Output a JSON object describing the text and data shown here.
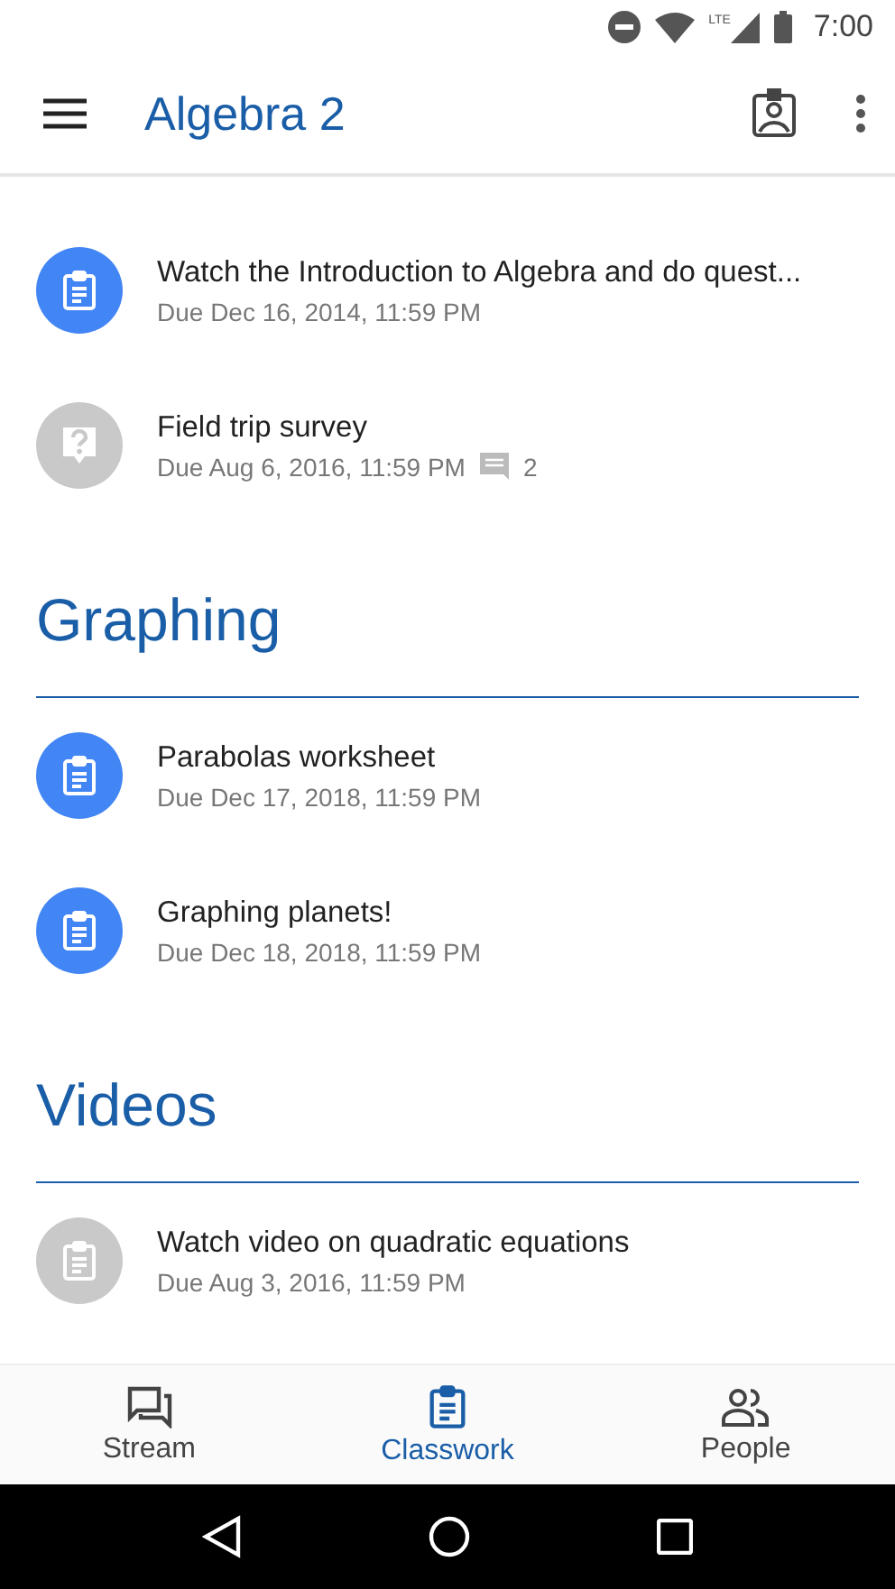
{
  "status_bar": {
    "time": "7:00",
    "network": "LTE"
  },
  "app_bar": {
    "title": "Algebra 2"
  },
  "sections": [
    {
      "items": [
        {
          "kind": "assignment",
          "active": true,
          "title": "Watch the Introduction to Algebra and do quest...",
          "due": "Due Dec 16, 2014, 11:59 PM"
        },
        {
          "kind": "question",
          "active": false,
          "title": "Field trip survey",
          "due": "Due Aug 6, 2016, 11:59 PM",
          "comments": "2"
        }
      ]
    },
    {
      "title": "Graphing",
      "items": [
        {
          "kind": "assignment",
          "active": true,
          "title": "Parabolas worksheet",
          "due": "Due Dec 17, 2018, 11:59 PM"
        },
        {
          "kind": "assignment",
          "active": true,
          "title": "Graphing planets!",
          "due": "Due Dec 18, 2018, 11:59 PM"
        }
      ]
    },
    {
      "title": "Videos",
      "items": [
        {
          "kind": "assignment",
          "active": false,
          "title": "Watch video on quadratic equations",
          "due": "Due Aug 3, 2016, 11:59 PM"
        }
      ]
    }
  ],
  "bottom_tabs": [
    {
      "kind": "stream",
      "label": "Stream",
      "selected": false
    },
    {
      "kind": "classwork",
      "label": "Classwork",
      "selected": true
    },
    {
      "kind": "people",
      "label": "People",
      "selected": false
    }
  ]
}
